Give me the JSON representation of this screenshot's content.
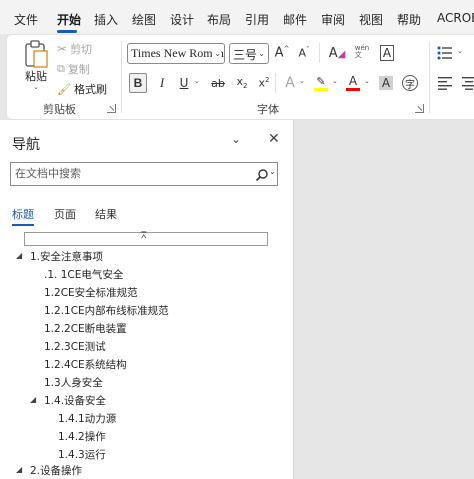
{
  "tabs": [
    "文件",
    "开始",
    "插入",
    "绘图",
    "设计",
    "布局",
    "引用",
    "邮件",
    "审阅",
    "视图",
    "帮助",
    "ACROBAT"
  ],
  "clipboard": {
    "paste_label": "粘贴",
    "cut_label": "剪切",
    "copy_label": "复制",
    "format_painter_label": "格式刷",
    "group_label": "剪贴板"
  },
  "font": {
    "font_name": "Times New Roman",
    "font_size": "三号",
    "group_label": "字体",
    "colors": {
      "highlight": "#ffff00",
      "font_color": "#ff0000",
      "accent": "#185abd"
    }
  },
  "nav": {
    "title": "导航",
    "search_placeholder": "在文档中搜索",
    "tabs": [
      "标题",
      "页面",
      "结果"
    ],
    "active_tab": "标题",
    "headings": [
      {
        "text": "1.安全注意事项",
        "level": 1,
        "expanded": true
      },
      {
        "text": ".1. 1CE电气安全",
        "level": 2
      },
      {
        "text": "1.2CE安全标准规范",
        "level": 2
      },
      {
        "text": "1.2.1CE内部布线标准规范",
        "level": 2
      },
      {
        "text": "1.2.2CE断电装置",
        "level": 2
      },
      {
        "text": "1.2.3CE测试",
        "level": 2
      },
      {
        "text": "1.2.4CE系统结构",
        "level": 2
      },
      {
        "text": "1.3人身安全",
        "level": 2
      },
      {
        "text": "1.4.设备安全",
        "level": 2,
        "expanded": true
      },
      {
        "text": "1.4.1动力源",
        "level": 3
      },
      {
        "text": "1.4.2操作",
        "level": 3
      },
      {
        "text": "1.4.3运行",
        "level": 3
      },
      {
        "text": "2.设备操作",
        "level": 1,
        "expanded": true
      }
    ]
  }
}
